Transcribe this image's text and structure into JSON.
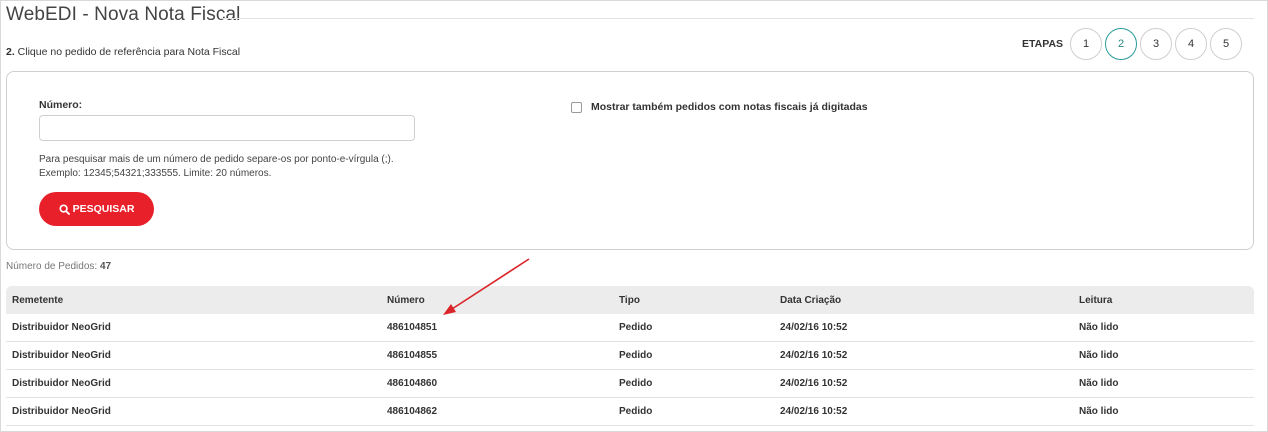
{
  "page": {
    "title": "WebEDI - Nova Nota Fiscal",
    "instruction_step": "2.",
    "instruction_text": " Clique no pedido de referência para Nota Fiscal"
  },
  "steps": {
    "label": "ETAPAS",
    "items": [
      "1",
      "2",
      "3",
      "4",
      "5"
    ],
    "active": "2",
    "accent_color": "#2a9a9a"
  },
  "search": {
    "number_label": "Número:",
    "number_value": "",
    "number_placeholder": "",
    "help_line1": "Para pesquisar mais de um número de pedido separe-os por ponto-e-vírgula (;).",
    "help_line2": "Exemplo: 12345;54321;333555. Limite: 20 números.",
    "button_label": "PESQUISAR",
    "button_icon": "search-icon",
    "button_color": "#e8202a",
    "show_invoiced_label": "Mostrar também pedidos com notas fiscais já digitadas",
    "show_invoiced_checked": false
  },
  "summary": {
    "count_label": "Número de Pedidos:",
    "count_value": "47"
  },
  "table": {
    "headers": [
      "Remetente",
      "Número",
      "Tipo",
      "Data Criação",
      "Leitura"
    ],
    "rows": [
      [
        "Distribuidor NeoGrid",
        "486104851",
        "Pedido",
        "24/02/16 10:52",
        "Não lido"
      ],
      [
        "Distribuidor NeoGrid",
        "486104855",
        "Pedido",
        "24/02/16 10:52",
        "Não lido"
      ],
      [
        "Distribuidor NeoGrid",
        "486104860",
        "Pedido",
        "24/02/16 10:52",
        "Não lido"
      ],
      [
        "Distribuidor NeoGrid",
        "486104862",
        "Pedido",
        "24/02/16 10:52",
        "Não lido"
      ]
    ]
  },
  "annotation": {
    "arrow_color": "#d9252a"
  }
}
